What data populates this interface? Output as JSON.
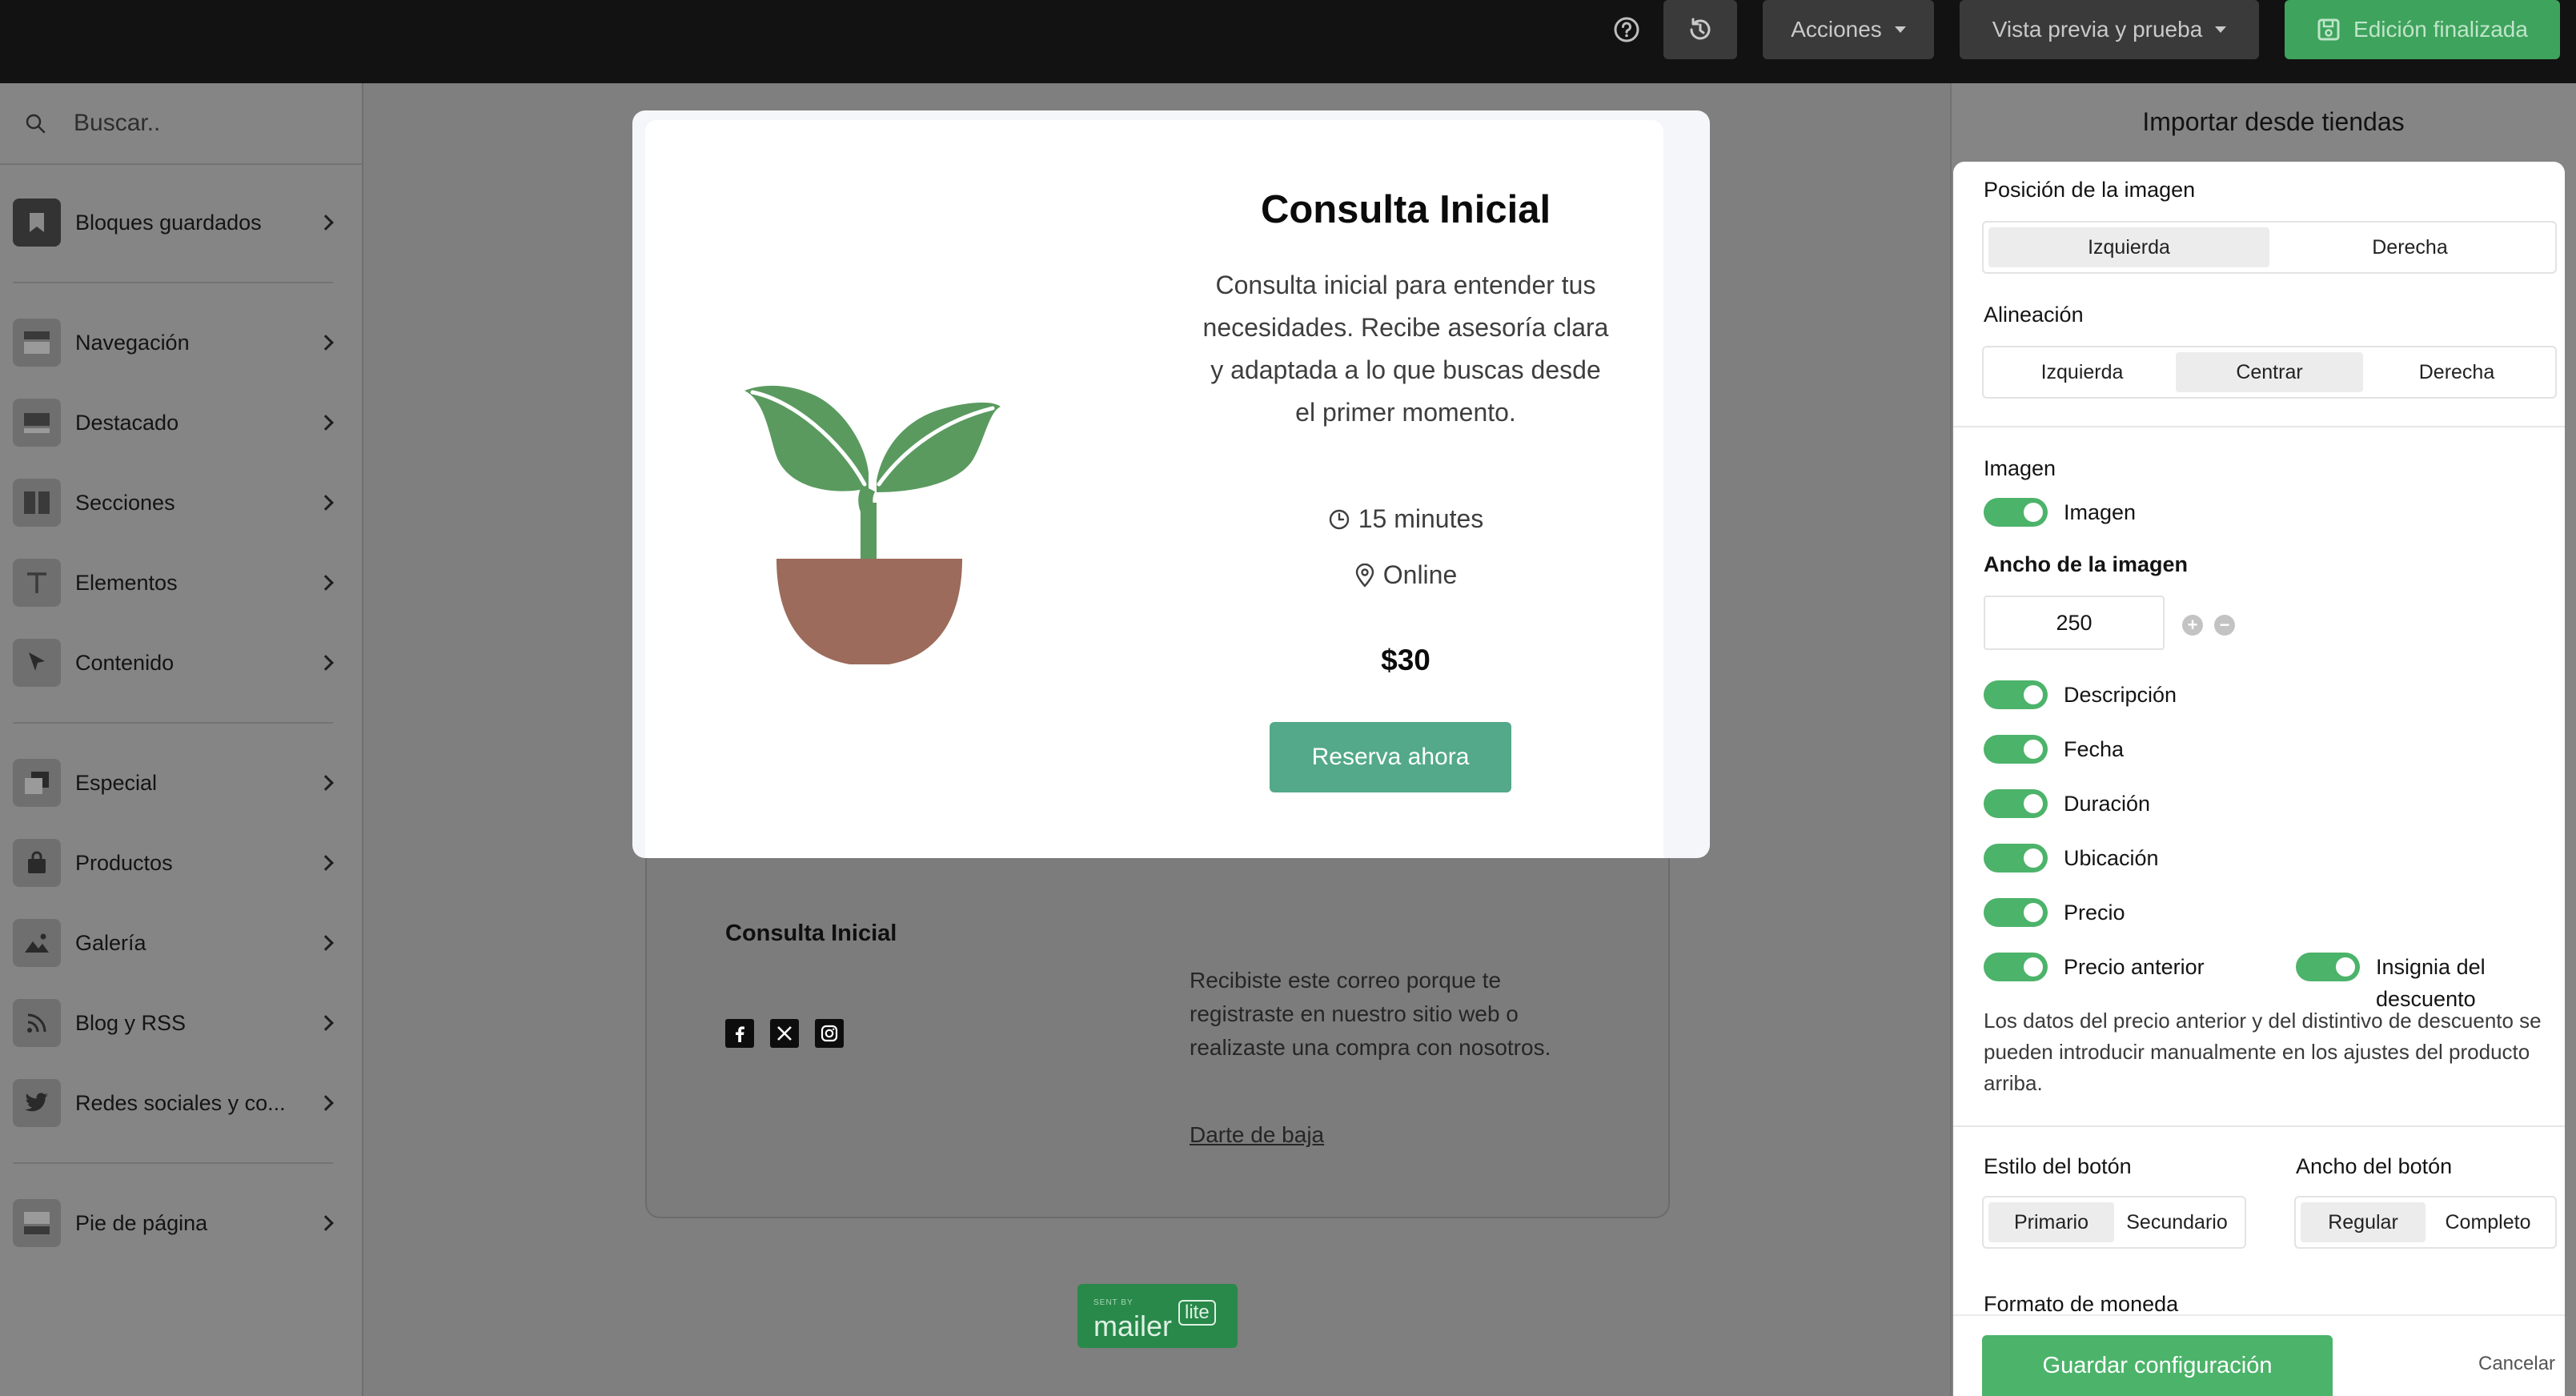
{
  "topbar": {
    "help_icon": "help-circle-icon",
    "history_icon": "history-icon",
    "actions_label": "Acciones",
    "preview_label": "Vista previa y prueba",
    "done_label": "Edición finalizada"
  },
  "sidebar": {
    "search_placeholder": "Buscar..",
    "items": [
      {
        "label": "Bloques guardados",
        "icon": "bookmark-icon"
      },
      {
        "label": "Navegación",
        "icon": "navigation-icon"
      },
      {
        "label": "Destacado",
        "icon": "featured-icon"
      },
      {
        "label": "Secciones",
        "icon": "sections-icon"
      },
      {
        "label": "Elementos",
        "icon": "text-icon"
      },
      {
        "label": "Contenido",
        "icon": "cursor-icon"
      },
      {
        "label": "Especial",
        "icon": "special-icon"
      },
      {
        "label": "Productos",
        "icon": "bag-icon"
      },
      {
        "label": "Galería",
        "icon": "image-icon"
      },
      {
        "label": "Blog y RSS",
        "icon": "rss-icon"
      },
      {
        "label": "Redes sociales y co...",
        "icon": "twitter-icon"
      },
      {
        "label": "Pie de página",
        "icon": "footer-icon"
      }
    ]
  },
  "product": {
    "title": "Consulta Inicial",
    "description": "Consulta inicial para entender tus necesidades. Recibe asesoría clara y adaptada a lo que buscas desde el primer momento.",
    "duration": "15 minutes",
    "location": "Online",
    "price": "$30",
    "button_label": "Reserva ahora"
  },
  "footer": {
    "title": "Consulta Inicial",
    "text": "Recibiste este correo porque te registraste en nuestro sitio web o realizaste una compra con nosotros.",
    "unsubscribe": "Darte de baja",
    "badge_sent": "SENT BY",
    "badge_brand": "mailer",
    "badge_lite": "lite"
  },
  "panel": {
    "title": "Importar desde tiendas",
    "image_position_label": "Posición de la imagen",
    "image_position_options": [
      "Izquierda",
      "Derecha"
    ],
    "alignment_label": "Alineación",
    "alignment_options": [
      "Izquierda",
      "Centrar",
      "Derecha"
    ],
    "image_section_label": "Imagen",
    "image_toggle_label": "Imagen",
    "image_width_label": "Ancho de la imagen",
    "image_width_value": "250",
    "toggles": {
      "description": "Descripción",
      "date": "Fecha",
      "duration": "Duración",
      "location": "Ubicación",
      "price": "Precio",
      "old_price": "Precio anterior",
      "discount_badge": "Insignia del descuento"
    },
    "note": "Los datos del precio anterior y del distintivo de descuento se pueden introducir manualmente en los ajustes del producto arriba.",
    "button_style_label": "Estilo del botón",
    "button_style_options": [
      "Primario",
      "Secundario"
    ],
    "button_width_label": "Ancho del botón",
    "button_width_options": [
      "Regular",
      "Completo"
    ],
    "currency_format_label": "Formato de moneda",
    "save_label": "Guardar configuración",
    "cancel_label": "Cancelar"
  },
  "colors": {
    "accent_green": "#4cb36a",
    "book_button": "#53a98a",
    "plant_leaf": "#5a9a5f",
    "plant_pot": "#9c6b5b"
  }
}
